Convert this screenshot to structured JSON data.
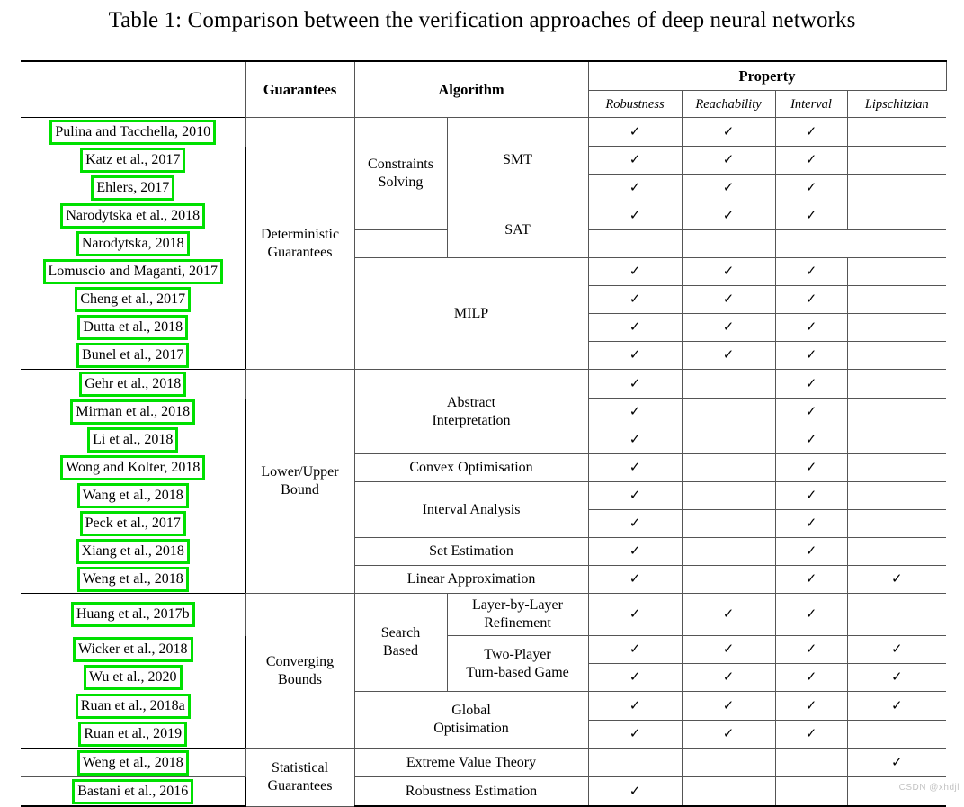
{
  "caption": "Table 1: Comparison between the verification approaches of deep neural networks",
  "watermark": "CSDN @xhdjl",
  "header": {
    "references_label": "",
    "guarantees": "Guarantees",
    "algorithm": "Algorithm",
    "property": "Property",
    "properties": [
      "Robustness",
      "Reachability",
      "Interval",
      "Lipschitzian"
    ]
  },
  "check": "✓",
  "colors": {
    "highlight_box": "#00e000",
    "rule": "#000000",
    "grid": "#555555",
    "watermark": "#c3c3c3"
  },
  "sections": [
    {
      "guarantee": "Deterministic\nGuarantees",
      "guarantee_line1": "Deterministic",
      "guarantee_line2": "Guarantees",
      "algorithm_group": "Constraints\nSolving",
      "algorithm_group_line1": "Constraints",
      "algorithm_group_line2": "Solving",
      "rows": [
        {
          "ref": "Pulina and Tacchella, 2010",
          "algo": "SMT",
          "props": [
            true,
            true,
            true,
            false
          ]
        },
        {
          "ref": "Katz et al., 2017",
          "algo": "SMT",
          "props": [
            true,
            true,
            true,
            false
          ]
        },
        {
          "ref": "Ehlers, 2017",
          "algo": "SMT",
          "props": [
            true,
            true,
            true,
            false
          ]
        },
        {
          "ref": "Narodytska et al., 2018",
          "algo": "SAT",
          "props": [
            true,
            true,
            true,
            false
          ]
        },
        {
          "ref": "Narodytska, 2018",
          "algo": "SAT",
          "props": [
            false,
            false,
            false,
            false
          ]
        },
        {
          "ref": "Lomuscio and Maganti, 2017",
          "algo": "MILP",
          "props": [
            true,
            true,
            true,
            false
          ]
        },
        {
          "ref": "Cheng et al., 2017",
          "algo": "MILP",
          "props": [
            true,
            true,
            true,
            false
          ]
        },
        {
          "ref": "Dutta et al., 2018",
          "algo": "MILP",
          "props": [
            true,
            true,
            true,
            false
          ]
        },
        {
          "ref": "Bunel et al., 2017",
          "algo": "MILP",
          "props": [
            true,
            true,
            true,
            false
          ]
        }
      ]
    },
    {
      "guarantee_line1": "Lower/Upper",
      "guarantee_line2": "Bound",
      "rows": [
        {
          "ref": "Gehr et al., 2018",
          "algo": "Abstract Interpretation",
          "props": [
            true,
            false,
            true,
            false
          ]
        },
        {
          "ref": "Mirman et al., 2018",
          "algo": "Abstract Interpretation",
          "props": [
            true,
            false,
            true,
            false
          ]
        },
        {
          "ref": "Li et al., 2018",
          "algo": "Abstract Interpretation",
          "props": [
            true,
            false,
            true,
            false
          ]
        },
        {
          "ref": "Wong and Kolter, 2018",
          "algo": "Convex Optimisation",
          "props": [
            true,
            false,
            true,
            false
          ]
        },
        {
          "ref": "Wang et al., 2018",
          "algo": "Interval Analysis",
          "props": [
            true,
            false,
            true,
            false
          ]
        },
        {
          "ref": "Peck et al., 2017",
          "algo": "Interval Analysis",
          "props": [
            true,
            false,
            true,
            false
          ]
        },
        {
          "ref": "Xiang et al., 2018",
          "algo": "Set Estimation",
          "props": [
            true,
            false,
            true,
            false
          ]
        },
        {
          "ref": "Weng et al., 2018",
          "algo": "Linear Approximation",
          "props": [
            true,
            false,
            true,
            true
          ]
        }
      ]
    },
    {
      "guarantee_line1": "Converging",
      "guarantee_line2": "Bounds",
      "algorithm_group_line1": "Search",
      "algorithm_group_line2": "Based",
      "rows": [
        {
          "ref": "Huang et al., 2017b",
          "algo": "Layer-by-Layer Refinement",
          "props": [
            true,
            true,
            true,
            false
          ]
        },
        {
          "ref": "Wicker et al., 2018",
          "algo": "Two-Player Turn-based Game",
          "props": [
            true,
            true,
            true,
            true
          ]
        },
        {
          "ref": "Wu et al., 2020",
          "algo": "Two-Player Turn-based Game",
          "props": [
            true,
            true,
            true,
            true
          ]
        },
        {
          "ref": "Ruan et al., 2018a",
          "algo": "Global Optisimation",
          "props": [
            true,
            true,
            true,
            true
          ]
        },
        {
          "ref": "Ruan et al., 2019",
          "algo": "Global Optisimation",
          "props": [
            true,
            true,
            true,
            false
          ]
        }
      ]
    },
    {
      "guarantee_line1": "Statistical",
      "guarantee_line2": "Guarantees",
      "rows": [
        {
          "ref": "Weng et al., 2018",
          "algo": "Extreme Value Theory",
          "props": [
            false,
            false,
            false,
            true
          ]
        },
        {
          "ref": "Bastani et al., 2016",
          "algo": "Robustness Estimation",
          "props": [
            true,
            false,
            false,
            false
          ]
        }
      ]
    }
  ],
  "algorithm_labels": {
    "smt": "SMT",
    "sat": "SAT",
    "milp": "MILP",
    "abstract_l1": "Abstract",
    "abstract_l2": "Interpretation",
    "convex": "Convex Optimisation",
    "interval": "Interval Analysis",
    "set_est": "Set Estimation",
    "linear_approx": "Linear Approximation",
    "layer_l1": "Layer-by-Layer",
    "layer_l2": "Refinement",
    "twoplayer_l1": "Two-Player",
    "twoplayer_l2": "Turn-based Game",
    "global_l1": "Global",
    "global_l2": "Optisimation",
    "evt": "Extreme Value Theory",
    "robust_est": "Robustness Estimation"
  }
}
